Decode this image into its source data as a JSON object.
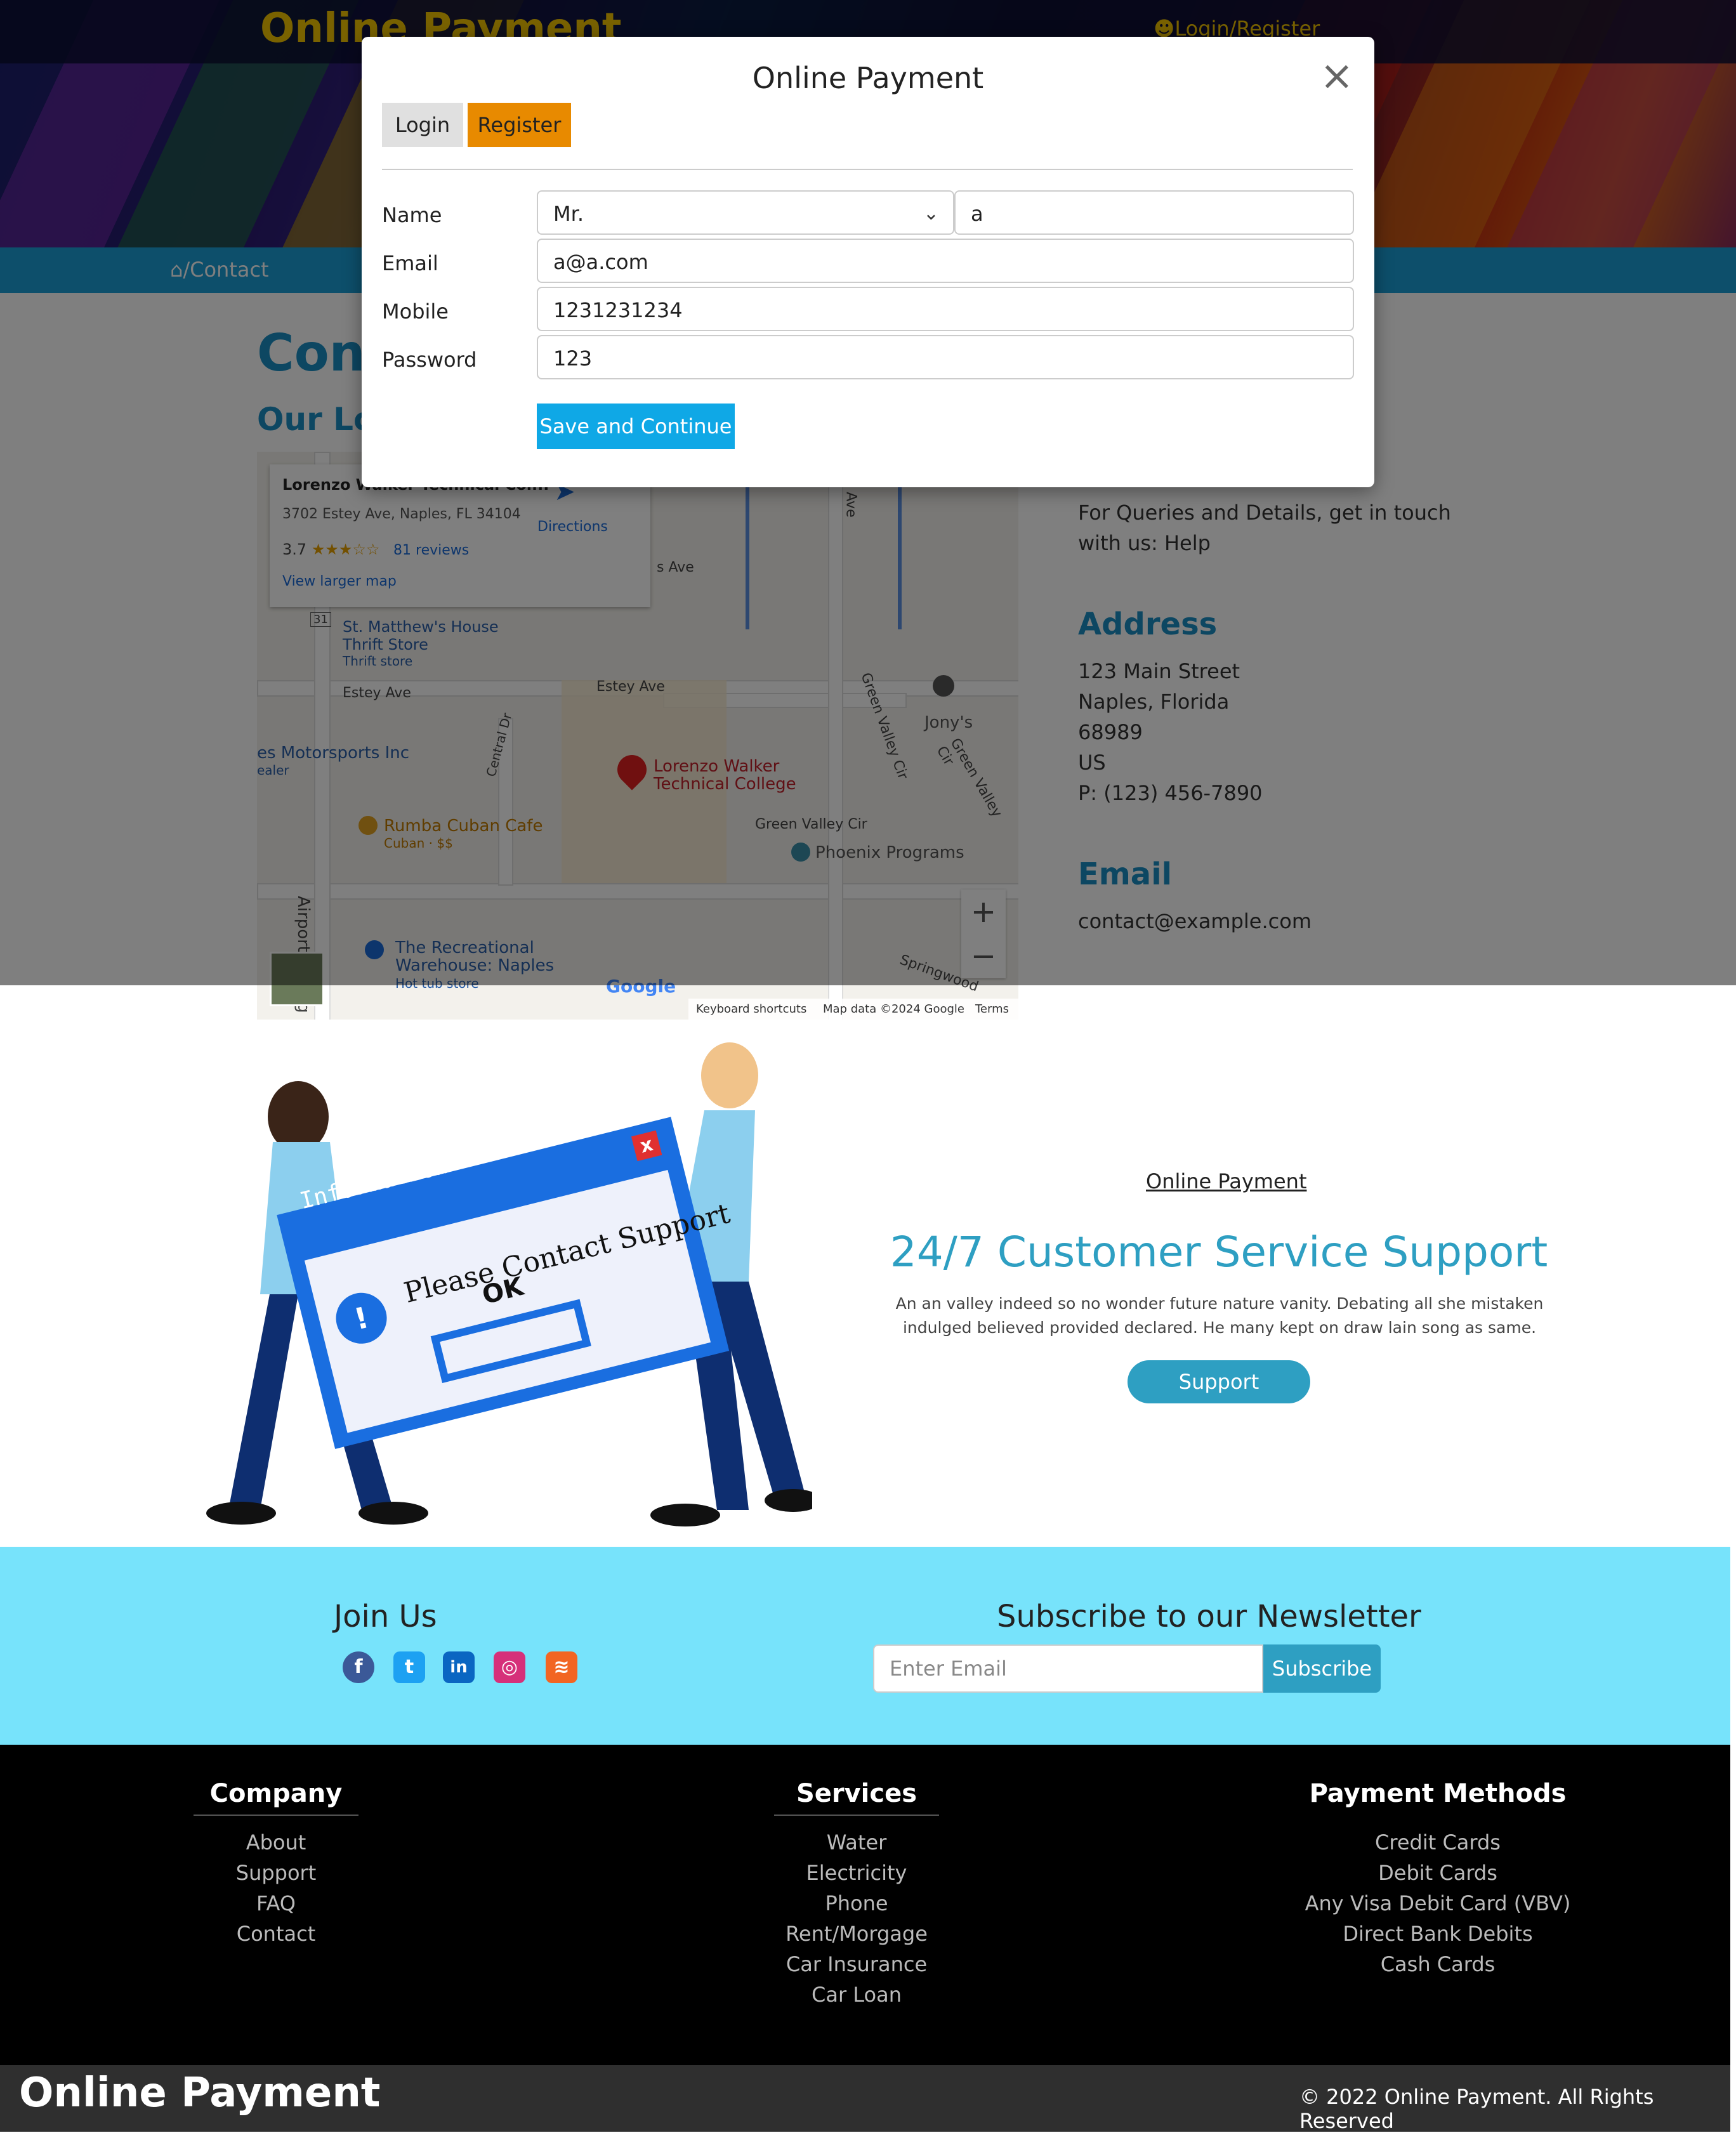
{
  "header": {
    "title": "Online Payment",
    "login_label": "Login/Register"
  },
  "breadcrumb": {
    "text": "/Contact"
  },
  "page": {
    "heading": "Cont",
    "subheading": "Our Loc"
  },
  "map": {
    "place_name": "Lorenzo Walker Technical Col...",
    "address": "3702 Estey Ave, Naples, FL 34104",
    "rating": "3.7",
    "reviews": "81 reviews",
    "directions": "Directions",
    "view_larger": "View larger map",
    "labels": {
      "thrift": "St. Matthew's House Thrift Store",
      "thrift_sub": "Thrift store",
      "estey1": "Estey Ave",
      "estey2": "Estey Ave",
      "motorsports": "es Motorsports Inc",
      "dealer": "ealer",
      "central": "Central Dr",
      "college": "Lorenzo Walker Technical College",
      "rumba": "Rumba Cuban Cafe",
      "rumba_sub": "Cuban · $$",
      "airport": "Airport-Pulling Rd S",
      "green_valley": "Green Valley Cir",
      "green_valley2": "Green Valley Cir",
      "green_valley3": "Green Valley Cir",
      "phoenix": "Phoenix Programs",
      "jonys": "Jony's",
      "recreational": "The Recreational Warehouse: Naples",
      "hot_tub": "Hot tub store",
      "springwood": "Springwood",
      "ave": "s Ave",
      "mo_ave": "mo Ave",
      "route": "31",
      "google": "Google",
      "shortcuts": "Keyboard shortcuts",
      "map_data": "Map data ©2024 Google",
      "terms": "Terms",
      "zoom_in": "+",
      "zoom_out": "−"
    }
  },
  "contact_info": {
    "queries": "For Queries and Details, get in touch with us: Help",
    "address_heading": "Address",
    "address_lines": [
      "123 Main Street",
      "Naples, Florida",
      "68989",
      "US",
      "P: (123) 456-7890"
    ],
    "email_heading": "Email",
    "email": "contact@example.com"
  },
  "modal": {
    "title": "Online Payment",
    "close": "×",
    "tabs": {
      "login": "Login",
      "register": "Register"
    },
    "labels": {
      "name": "Name",
      "email": "Email",
      "mobile": "Mobile",
      "password": "Password"
    },
    "values": {
      "salutation": "Mr.",
      "name": "a",
      "email": "a@a.com",
      "mobile": "1231231234",
      "password": "123"
    },
    "save_button": "Save and Continue"
  },
  "support": {
    "label": "Online Payment",
    "title": "24/7 Customer Service Support",
    "text": "An an valley indeed so no wonder future nature vanity. Debating all she mistaken indulged believed provided declared. He many kept on draw lain song as same.",
    "button": "Support",
    "illustration": {
      "header": "Information",
      "message": "Please Contact Support",
      "ok": "OK"
    }
  },
  "join": {
    "heading": "Join Us",
    "newsletter_heading": "Subscribe to our Newsletter",
    "email_placeholder": "Enter Email",
    "subscribe": "Subscribe",
    "social": [
      "facebook-icon",
      "twitter-icon",
      "linkedin-icon",
      "instagram-icon",
      "rss-icon"
    ],
    "social_glyphs": [
      "f",
      "t",
      "in",
      "◎",
      "≋"
    ]
  },
  "footer": {
    "company": {
      "heading": "Company",
      "items": [
        "About",
        "Support",
        "FAQ",
        "Contact"
      ]
    },
    "services": {
      "heading": "Services",
      "items": [
        "Water",
        "Electricity",
        "Phone",
        "Rent/Morgage",
        "Car Insurance",
        "Car Loan"
      ]
    },
    "payment": {
      "heading": "Payment Methods",
      "items": [
        "Credit Cards",
        "Debit Cards",
        "Any Visa Debit Card (VBV)",
        "Direct Bank Debits",
        "Cash Cards"
      ]
    },
    "bottom_title": "Online Payment",
    "copyright": "© 2022 Online Payment. All Rights Reserved"
  },
  "colors": {
    "accent": "#1a9fd6",
    "brand_yellow": "#f2c400",
    "register_tab": "#e88a00",
    "support": "#2e9fc2",
    "join_bg": "#77e3fb"
  }
}
